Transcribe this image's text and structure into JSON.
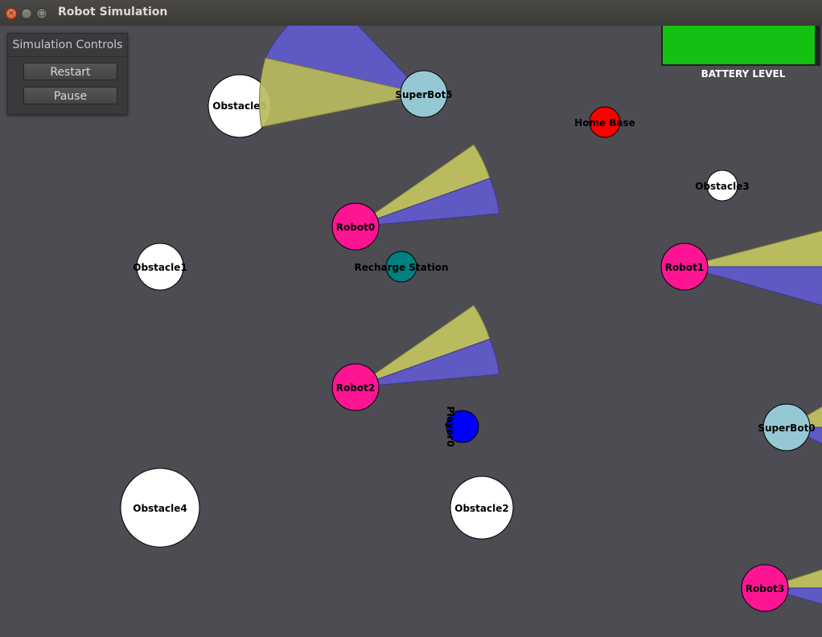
{
  "window": {
    "title": "Robot Simulation",
    "close_glyph": "×",
    "minimize_glyph": "–",
    "maximize_glyph": "□"
  },
  "controls": {
    "title": "Simulation Controls",
    "restart_label": "Restart",
    "pause_label": "Pause"
  },
  "battery": {
    "label": "BATTERY LEVEL",
    "color": "#12c112"
  },
  "entities": {
    "obstacle5": {
      "label": "Obstacle5",
      "kind": "obstacle"
    },
    "superbot5": {
      "label": "SuperBot5",
      "kind": "superbot"
    },
    "home_base": {
      "label": "Home Base",
      "kind": "home-base"
    },
    "obstacle3": {
      "label": "Obstacle3",
      "kind": "obstacle"
    },
    "robot0": {
      "label": "Robot0",
      "kind": "robot"
    },
    "obstacle1": {
      "label": "Obstacle1",
      "kind": "obstacle"
    },
    "recharge_station": {
      "label": "Recharge Station",
      "kind": "recharge-station"
    },
    "robot1": {
      "label": "Robot1",
      "kind": "robot"
    },
    "robot2": {
      "label": "Robot2",
      "kind": "robot"
    },
    "player0": {
      "label": "Player0",
      "kind": "player"
    },
    "superbot0": {
      "label": "SuperBot0",
      "kind": "superbot"
    },
    "obstacle4": {
      "label": "Obstacle4",
      "kind": "obstacle"
    },
    "obstacle2": {
      "label": "Obstacle2",
      "kind": "obstacle"
    },
    "robot3": {
      "label": "Robot3",
      "kind": "robot"
    }
  },
  "colors": {
    "background": "#4c4c52",
    "obstacle": "#ffffff",
    "robot": "#ff1493",
    "superbot": "#96c8d4",
    "home_base": "#ff0000",
    "recharge_station": "#008080",
    "player": "#0000ff",
    "sensor_left": "#babb5e",
    "sensor_right": "#5f59c4"
  }
}
